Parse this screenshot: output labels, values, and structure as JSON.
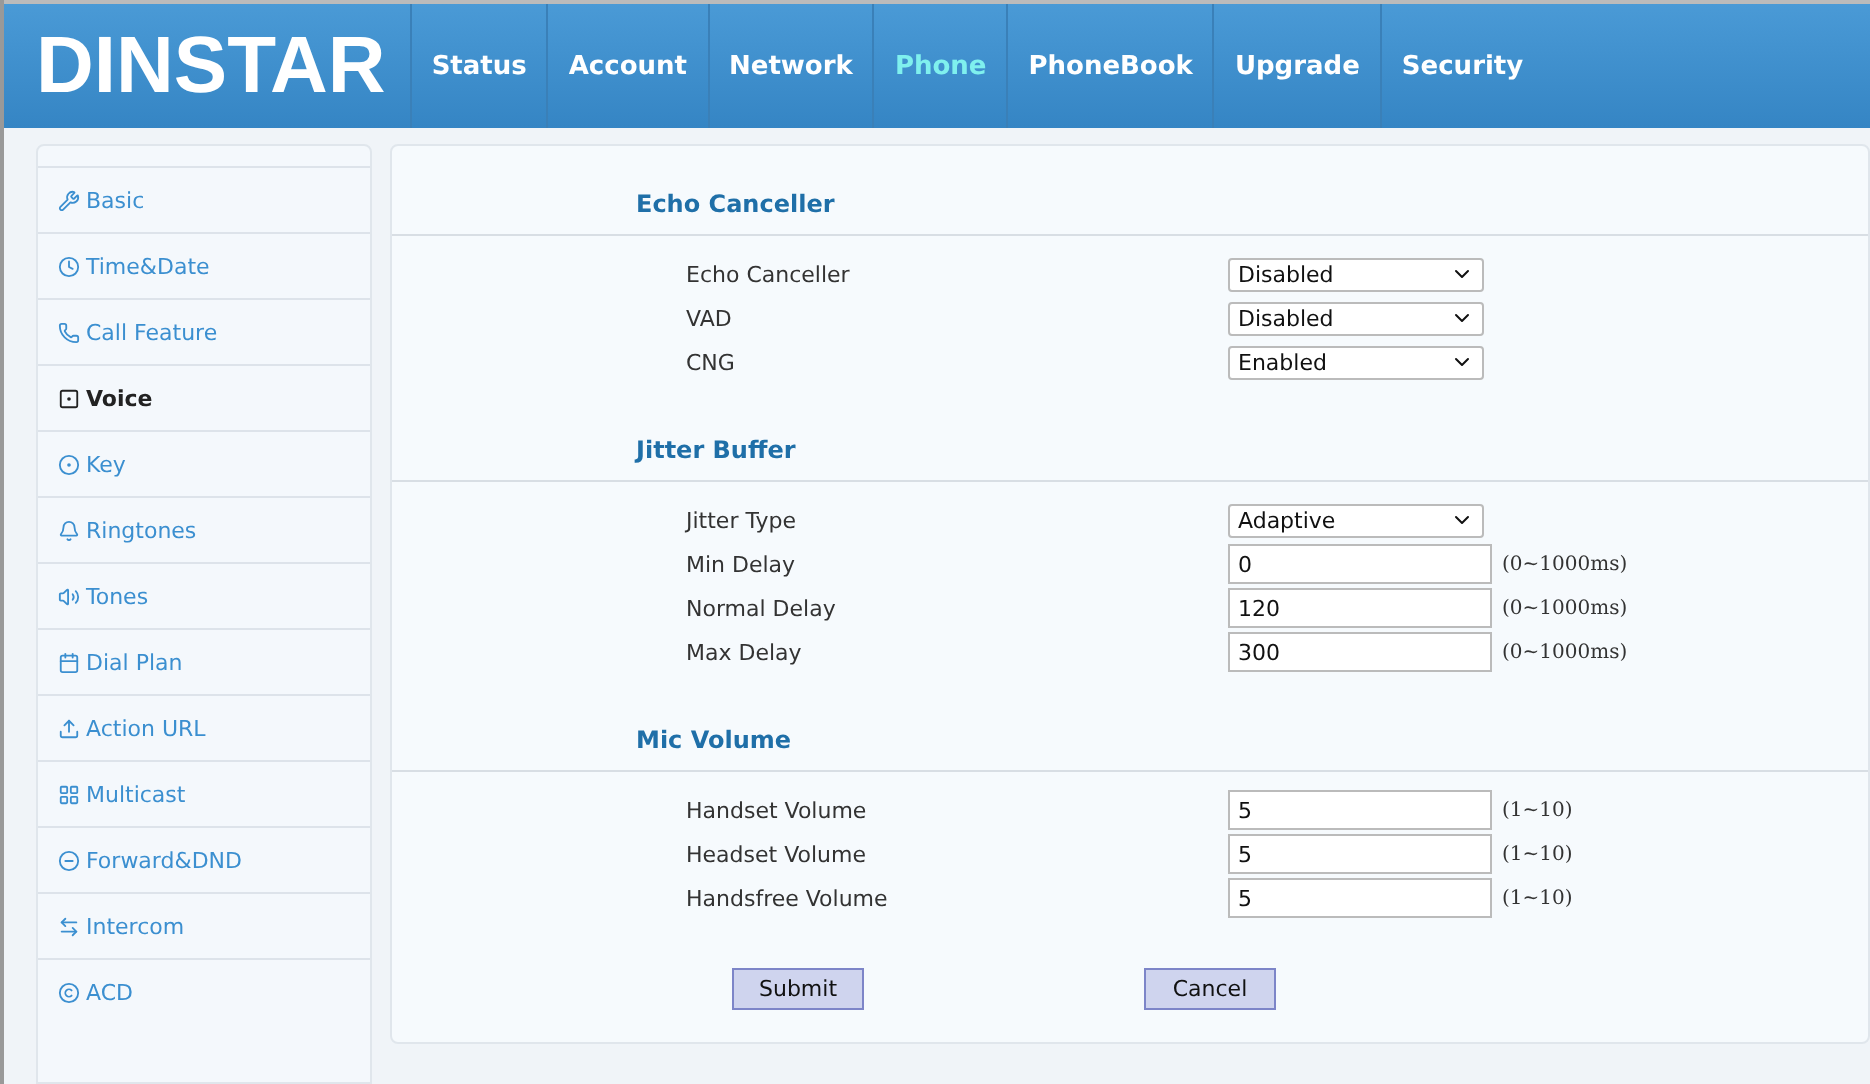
{
  "header": {
    "logo": "DINSTAR",
    "tabs": [
      {
        "label": "Status",
        "selected": false
      },
      {
        "label": "Account",
        "selected": false
      },
      {
        "label": "Network",
        "selected": false
      },
      {
        "label": "Phone",
        "selected": true
      },
      {
        "label": "PhoneBook",
        "selected": false
      },
      {
        "label": "Upgrade",
        "selected": false
      },
      {
        "label": "Security",
        "selected": false
      }
    ]
  },
  "sidebar": {
    "items": [
      {
        "label": "Basic",
        "selected": false
      },
      {
        "label": "Time&Date",
        "selected": false
      },
      {
        "label": "Call Feature",
        "selected": false
      },
      {
        "label": "Voice",
        "selected": true
      },
      {
        "label": "Key",
        "selected": false
      },
      {
        "label": "Ringtones",
        "selected": false
      },
      {
        "label": "Tones",
        "selected": false
      },
      {
        "label": "Dial Plan",
        "selected": false
      },
      {
        "label": "Action URL",
        "selected": false
      },
      {
        "label": "Multicast",
        "selected": false
      },
      {
        "label": "Forward&DND",
        "selected": false
      },
      {
        "label": "Intercom",
        "selected": false
      },
      {
        "label": "ACD",
        "selected": false
      }
    ]
  },
  "sections": [
    {
      "title": "Echo Canceller",
      "rows": [
        {
          "kind": "select",
          "label": "Echo Canceller",
          "value": "Disabled"
        },
        {
          "kind": "select",
          "label": "VAD",
          "value": "Disabled"
        },
        {
          "kind": "select",
          "label": "CNG",
          "value": "Enabled"
        }
      ]
    },
    {
      "title": "Jitter Buffer",
      "rows": [
        {
          "kind": "select",
          "label": "Jitter Type",
          "value": "Adaptive"
        },
        {
          "kind": "input",
          "label": "Min Delay",
          "value": "0",
          "hint": "(0~1000ms)"
        },
        {
          "kind": "input",
          "label": "Normal Delay",
          "value": "120",
          "hint": "(0~1000ms)"
        },
        {
          "kind": "input",
          "label": "Max Delay",
          "value": "300",
          "hint": "(0~1000ms)"
        }
      ]
    },
    {
      "title": "Mic Volume",
      "rows": [
        {
          "kind": "input",
          "label": "Handset Volume",
          "value": "5",
          "hint": "(1~10)"
        },
        {
          "kind": "input",
          "label": "Headset Volume",
          "value": "5",
          "hint": "(1~10)"
        },
        {
          "kind": "input",
          "label": "Handsfree Volume",
          "value": "5",
          "hint": "(1~10)"
        }
      ]
    }
  ],
  "buttons": [
    "Submit",
    "Cancel"
  ]
}
